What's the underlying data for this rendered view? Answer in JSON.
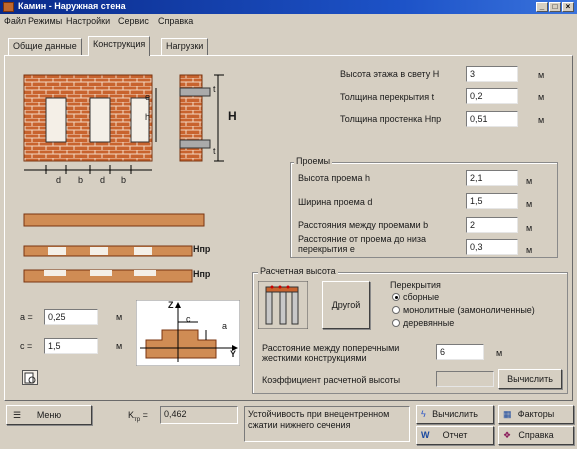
{
  "window": {
    "title": "Камин - Наружная стена",
    "buttons": [
      "_",
      "□",
      "×"
    ]
  },
  "menu": [
    "Файл",
    "Режимы",
    "Настройки",
    "Сервис",
    "Справка"
  ],
  "tabs": [
    "Общие данные",
    "Конструкция",
    "Нагрузки"
  ],
  "diagram": {
    "e": "e",
    "h": "h",
    "t": "t",
    "H": "H",
    "d": "d",
    "b": "b",
    "Hpr": "Hпр"
  },
  "params": {
    "floor_height": {
      "label": "Высота этажа в свету H",
      "value": "3",
      "unit": "м"
    },
    "slab_thickness": {
      "label": "Толщина перекрытия t",
      "value": "0,2",
      "unit": "м"
    },
    "pier_thickness": {
      "label": "Толщина простенка Hпр",
      "value": "0,51",
      "unit": "м"
    }
  },
  "openings": {
    "title": "Проемы",
    "height": {
      "label": "Высота проема h",
      "value": "2,1",
      "unit": "м"
    },
    "width": {
      "label": "Ширина проема d",
      "value": "1,5",
      "unit": "м"
    },
    "spacing": {
      "label": "Расстояния между проемами b",
      "value": "2",
      "unit": "м"
    },
    "distance_line1": "Расстояние от проема до низа",
    "distance_line2": "перекрытия e",
    "distance": {
      "value": "0,3",
      "unit": "м"
    }
  },
  "section": {
    "a": {
      "label": "a =",
      "value": "0,25",
      "unit": "м"
    },
    "c": {
      "label": "c =",
      "value": "1,5",
      "unit": "м"
    },
    "z": "Z",
    "y": "Y",
    "c_mark": "c",
    "a_mark": "a"
  },
  "design_height": {
    "title": "Расчетная высота",
    "other_button": "Другой",
    "slabs_title": "Перекрытия",
    "options": [
      "сборные",
      "монолитные (замоноличенные)",
      "деревянные"
    ],
    "selected_index": 0,
    "transverse_line1": "Расстояние между поперечными",
    "transverse_line2": "жесткими конструкциями",
    "transverse": {
      "value": "6",
      "unit": "м"
    },
    "coef_label": "Коэффициент расчетной высоты",
    "coef_value": "",
    "calc_button": "Вычислить"
  },
  "status": {
    "menu_button": "Меню",
    "k_label": "K",
    "k_sub": "тр",
    "k_value": "0,462",
    "message": "Устойчивость при внецентренном сжатии нижнего сечения",
    "calc_button": "Вычислить",
    "factors_button": "Факторы",
    "report_button": "Отчет",
    "help_button": "Справка"
  }
}
